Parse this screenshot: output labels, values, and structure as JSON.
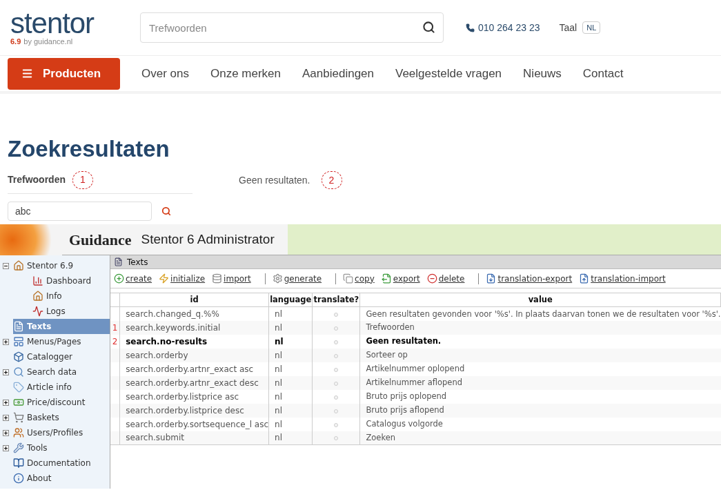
{
  "header": {
    "logo": "stentor",
    "version": "6.9",
    "by": "by guidance.nl",
    "search": {
      "placeholder": "Trefwoorden"
    },
    "phone": "010 264 23 23",
    "language_label": "Taal",
    "language": "NL"
  },
  "nav": {
    "products": "Producten",
    "links": [
      "Over ons",
      "Onze merken",
      "Aanbiedingen",
      "Veelgestelde vragen",
      "Nieuws",
      "Contact"
    ]
  },
  "results": {
    "title": "Zoekresultaten",
    "keywords_label": "Trefwoorden",
    "keywords_marker": "1",
    "message": "Geen resultaten.",
    "message_marker": "2",
    "query": "abc"
  },
  "admin": {
    "brand": "Guidance",
    "title": "Stentor 6 Administrator",
    "sidebar": [
      {
        "label": "Stentor 6.9",
        "kind": "folder",
        "expanded": true,
        "selected": false,
        "children": [
          {
            "label": "Dashboard",
            "selected": false
          },
          {
            "label": "Info",
            "selected": false
          },
          {
            "label": "Logs",
            "selected": false
          }
        ]
      },
      {
        "label": "Texts",
        "kind": "leaf",
        "selected": true
      },
      {
        "label": "Menus/Pages",
        "kind": "folder",
        "expanded": false,
        "selected": false
      },
      {
        "label": "Catalogger",
        "kind": "leaf",
        "selected": false
      },
      {
        "label": "Search data",
        "kind": "folder",
        "expanded": false,
        "selected": false
      },
      {
        "label": "Article info",
        "kind": "leaf",
        "selected": false
      },
      {
        "label": "Price/discount",
        "kind": "folder",
        "expanded": false,
        "selected": false
      },
      {
        "label": "Baskets",
        "kind": "folder",
        "expanded": false,
        "selected": false
      },
      {
        "label": "Users/Profiles",
        "kind": "folder",
        "expanded": false,
        "selected": false
      },
      {
        "label": "Tools",
        "kind": "folder",
        "expanded": false,
        "selected": false
      },
      {
        "label": "Documentation",
        "kind": "leaf",
        "selected": false
      },
      {
        "label": "About",
        "kind": "leaf",
        "selected": false
      }
    ],
    "panel_title": "Texts",
    "toolbar": [
      [
        "create",
        "initialize",
        "import"
      ],
      [
        "generate"
      ],
      [
        "copy",
        "export",
        "delete"
      ],
      [
        "translation-export",
        "translation-import"
      ]
    ],
    "columns": [
      "id",
      "language",
      "translate?",
      "value"
    ],
    "rows": [
      {
        "marker": "",
        "id": "search.changed_q.%%",
        "language": "nl",
        "translate": false,
        "value": "Geen resultaten gevonden voor '%s'. In plaats daarvan tonen we de resultaten voor '%s'.",
        "highlighted": false
      },
      {
        "marker": "1",
        "id": "search.keywords.initial",
        "language": "nl",
        "translate": false,
        "value": "Trefwoorden",
        "highlighted": false
      },
      {
        "marker": "2",
        "id": "search.no-results",
        "language": "nl",
        "translate": false,
        "value": "Geen resultaten.",
        "highlighted": true
      },
      {
        "marker": "",
        "id": "search.orderby",
        "language": "nl",
        "translate": false,
        "value": "Sorteer op",
        "highlighted": false
      },
      {
        "marker": "",
        "id": "search.orderby.artnr_exact asc",
        "language": "nl",
        "translate": false,
        "value": "Artikelnummer oplopend",
        "highlighted": false
      },
      {
        "marker": "",
        "id": "search.orderby.artnr_exact desc",
        "language": "nl",
        "translate": false,
        "value": "Artikelnummer aflopend",
        "highlighted": false
      },
      {
        "marker": "",
        "id": "search.orderby.listprice asc",
        "language": "nl",
        "translate": false,
        "value": "Bruto prijs oplopend",
        "highlighted": false
      },
      {
        "marker": "",
        "id": "search.orderby.listprice desc",
        "language": "nl",
        "translate": false,
        "value": "Bruto prijs aflopend",
        "highlighted": false
      },
      {
        "marker": "",
        "id": "search.orderby.sortsequence_l asc",
        "language": "nl",
        "translate": false,
        "value": "Catalogus volgorde",
        "highlighted": false
      },
      {
        "marker": "",
        "id": "search.submit",
        "language": "nl",
        "translate": false,
        "value": "Zoeken",
        "highlighted": false
      }
    ]
  }
}
